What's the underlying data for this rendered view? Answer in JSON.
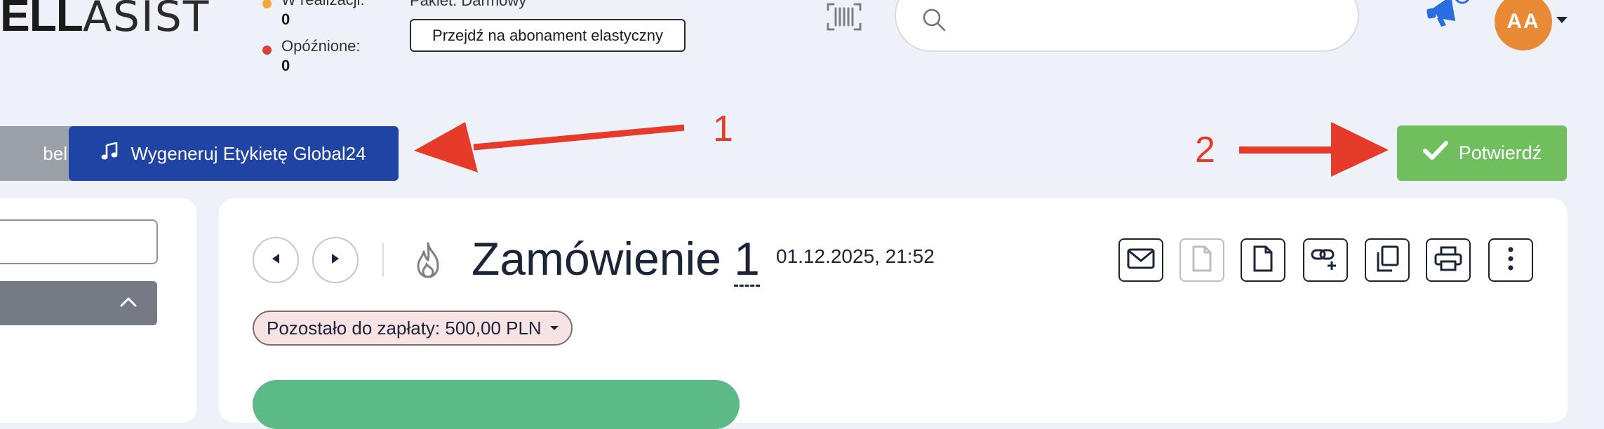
{
  "header": {
    "logo_part1": "ELL",
    "logo_part2": "ASIST",
    "stats": [
      {
        "label": "W realizacji:",
        "value": "0",
        "color": "#f2a93b"
      },
      {
        "label": "Opóźnione:",
        "value": "0",
        "color": "#d9423a"
      }
    ],
    "plan_label": "Pakiet: Darmowy",
    "plan_button": "Przejdź na abonament elastyczny",
    "search_placeholder": "",
    "avatar_initials": "AA",
    "icons": [
      "barcode-icon",
      "search-icon",
      "megaphone-icon",
      "chevron-down-icon"
    ]
  },
  "actions": {
    "gray_button_label": "bel",
    "blue_button_label": "Wygeneruj Etykietę Global24",
    "confirm_button_label": "Potwierdź",
    "annotation_1": "1",
    "annotation_2": "2"
  },
  "order": {
    "title": "Zamówienie",
    "number": "1",
    "date": "01.12.2025, 21:52",
    "payment_remaining": "Pozostało do zapłaty: 500,00 PLN",
    "toolbar_icons": [
      "envelope-icon",
      "document-icon",
      "document-icon",
      "link-add-icon",
      "copy-icon",
      "print-icon",
      "more-vertical-icon"
    ]
  },
  "colors": {
    "accent_blue": "#1f44a3",
    "confirm_green": "#6fbf5e",
    "annotation_red": "#e63b2a",
    "avatar_orange": "#e98a36"
  }
}
